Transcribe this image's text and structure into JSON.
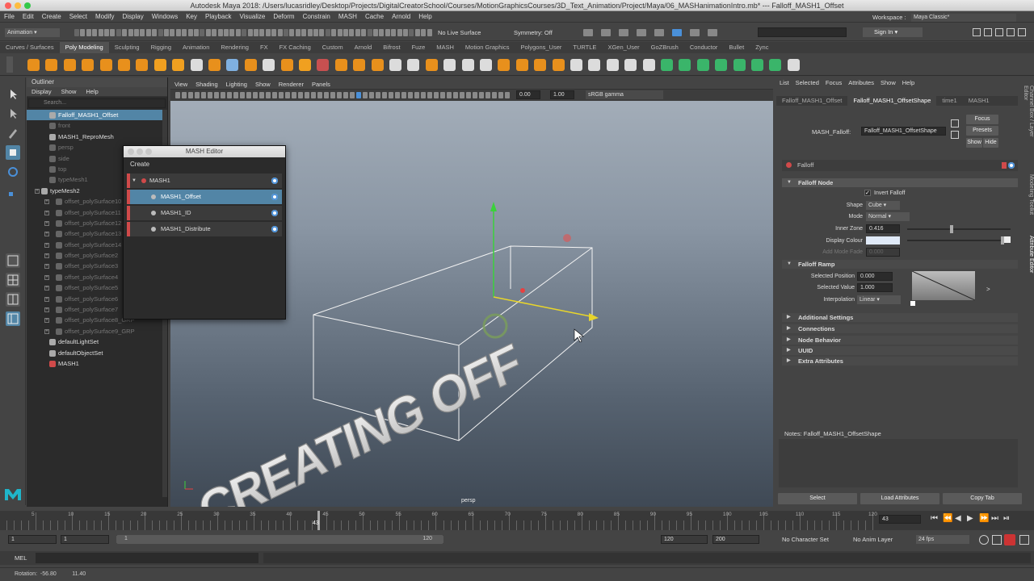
{
  "window_title": "Autodesk Maya 2018: /Users/lucasridley/Desktop/Projects/DigitalCreatorSchool/Courses/MotionGraphicsCourses/3D_Text_Animation/Project/Maya/06_MASHanimationIntro.mb*  ---  Falloff_MASH1_Offset",
  "menubar": [
    "File",
    "Edit",
    "Create",
    "Select",
    "Modify",
    "Display",
    "Windows",
    "Key",
    "Playback",
    "Visualize",
    "Deform",
    "Constrain",
    "MASH",
    "Cache",
    "Arnold",
    "Help"
  ],
  "status": {
    "menuset": "Animation",
    "live_surface": "No Live Surface",
    "symmetry": "Symmetry: Off",
    "workspace_label": "Workspace :",
    "workspace_value": "Maya Classic*",
    "sign_in": "Sign In"
  },
  "shelf_tabs": [
    "Curves / Surfaces",
    "Poly Modeling",
    "Sculpting",
    "Rigging",
    "Animation",
    "Rendering",
    "FX",
    "FX Caching",
    "Custom",
    "Arnold",
    "Bifrost",
    "Fuze",
    "MASH",
    "Motion Graphics",
    "Polygons_User",
    "TURTLE",
    "XGen_User",
    "GoZBrush",
    "Conductor",
    "Bullet",
    "Zync"
  ],
  "shelf_active": "Poly Modeling",
  "outliner": {
    "title": "Outliner",
    "menu": [
      "Display",
      "Show",
      "Help"
    ],
    "search_placeholder": "Search...",
    "items": [
      {
        "label": "Falloff_MASH1_Offset",
        "state": "sel",
        "indent": 1
      },
      {
        "label": "front",
        "state": "dim",
        "indent": 1
      },
      {
        "label": "MASH1_ReproMesh",
        "state": "",
        "indent": 1
      },
      {
        "label": "persp",
        "state": "dim",
        "indent": 1
      },
      {
        "label": "side",
        "state": "dim",
        "indent": 1
      },
      {
        "label": "top",
        "state": "dim",
        "indent": 1
      },
      {
        "label": "typeMesh1",
        "state": "dim",
        "indent": 1
      },
      {
        "label": "typeMesh2",
        "state": "",
        "indent": 0
      },
      {
        "label": "offset_polySurface10",
        "state": "dim",
        "indent": 2
      },
      {
        "label": "offset_polySurface11",
        "state": "dim",
        "indent": 2
      },
      {
        "label": "offset_polySurface12",
        "state": "dim",
        "indent": 2
      },
      {
        "label": "offset_polySurface13",
        "state": "dim",
        "indent": 2
      },
      {
        "label": "offset_polySurface14",
        "state": "dim",
        "indent": 2
      },
      {
        "label": "offset_polySurface2",
        "state": "dim",
        "indent": 2
      },
      {
        "label": "offset_polySurface3",
        "state": "dim",
        "indent": 2
      },
      {
        "label": "offset_polySurface4",
        "state": "dim",
        "indent": 2
      },
      {
        "label": "offset_polySurface5",
        "state": "dim",
        "indent": 2
      },
      {
        "label": "offset_polySurface6",
        "state": "dim",
        "indent": 2
      },
      {
        "label": "offset_polySurface7",
        "state": "dim",
        "indent": 2
      },
      {
        "label": "offset_polySurface8_GRP",
        "state": "dim",
        "indent": 2
      },
      {
        "label": "offset_polySurface9_GRP",
        "state": "dim",
        "indent": 2
      },
      {
        "label": "defaultLightSet",
        "state": "",
        "indent": 1
      },
      {
        "label": "defaultObjectSet",
        "state": "",
        "indent": 1
      },
      {
        "label": "MASH1",
        "state": "",
        "indent": 1
      }
    ]
  },
  "viewport": {
    "menu": [
      "View",
      "Shading",
      "Lighting",
      "Show",
      "Renderer",
      "Panels"
    ],
    "exposure": "0.00",
    "gamma": "1.00",
    "color_space": "sRGB gamma",
    "camera_label": "persp",
    "text_object": "CREATING OFF"
  },
  "mash_editor": {
    "title": "MASH Editor",
    "create_label": "Create",
    "rows": [
      {
        "label": "MASH1",
        "selected": false
      },
      {
        "label": "MASH1_Offset",
        "selected": true
      },
      {
        "label": "MASH1_ID",
        "selected": false
      },
      {
        "label": "MASH1_Distribute",
        "selected": false
      }
    ]
  },
  "attribute_editor": {
    "menu": [
      "List",
      "Selected",
      "Focus",
      "Attributes",
      "Show",
      "Help"
    ],
    "tabs": [
      "Falloff_MASH1_Offset",
      "Falloff_MASH1_OffsetShape",
      "time1",
      "MASH1"
    ],
    "active_tab": "Falloff_MASH1_OffsetShape",
    "node_type_label": "MASH_Falloff:",
    "node_name": "Falloff_MASH1_OffsetShape",
    "buttons": {
      "focus": "Focus",
      "presets": "Presets",
      "show": "Show",
      "hide": "Hide"
    },
    "header": "Falloff",
    "falloff_node": "Falloff Node",
    "invert_falloff": "Invert Falloff",
    "shape_label": "Shape",
    "shape_value": "Cube",
    "mode_label": "Mode",
    "mode_value": "Normal",
    "inner_zone_label": "Inner Zone",
    "inner_zone_value": "0.416",
    "inner_zone_fraction": 0.416,
    "display_colour_label": "Display Colour",
    "display_colour": "#dfe9f7",
    "add_mode_fade_label": "Add Mode Fade",
    "add_mode_fade_value": "0.000",
    "falloff_ramp": "Falloff Ramp",
    "selected_position_label": "Selected Position",
    "selected_position_value": "0.000",
    "selected_value_label": "Selected Value",
    "selected_value_value": "1.000",
    "interpolation_label": "Interpolation",
    "interpolation_value": "Linear",
    "sections": [
      "Additional Settings",
      "Connections",
      "Node Behavior",
      "UUID",
      "Extra Attributes"
    ],
    "notes_label": "Notes:  Falloff_MASH1_OffsetShape",
    "bottom_buttons": [
      "Select",
      "Load Attributes",
      "Copy Tab"
    ],
    "side_tabs": [
      "Channel Box / Layer Editor",
      "Modeling Toolkit",
      "Attribute Editor"
    ]
  },
  "timeline": {
    "ticks": [
      "5",
      "10",
      "15",
      "20",
      "25",
      "30",
      "35",
      "40",
      "45",
      "50",
      "55",
      "60",
      "65",
      "70",
      "75",
      "80",
      "85",
      "90",
      "95",
      "100",
      "105",
      "110",
      "115",
      "120"
    ],
    "current_frame": "43",
    "current_frame_field": "43"
  },
  "range": {
    "start": "1",
    "start_inner": "1",
    "slider_start": "1",
    "slider_end": "120",
    "end_inner": "120",
    "end": "200",
    "character_set": "No Character Set",
    "anim_layer": "No Anim Layer",
    "fps": "24 fps"
  },
  "command_line": {
    "mode": "MEL"
  },
  "help_line": {
    "text": "Rotation:  -56.80          11.40"
  },
  "colors": {
    "selection": "#5285a6",
    "mash_red": "#d04a4a",
    "toggle_blue": "#4a90d9"
  }
}
